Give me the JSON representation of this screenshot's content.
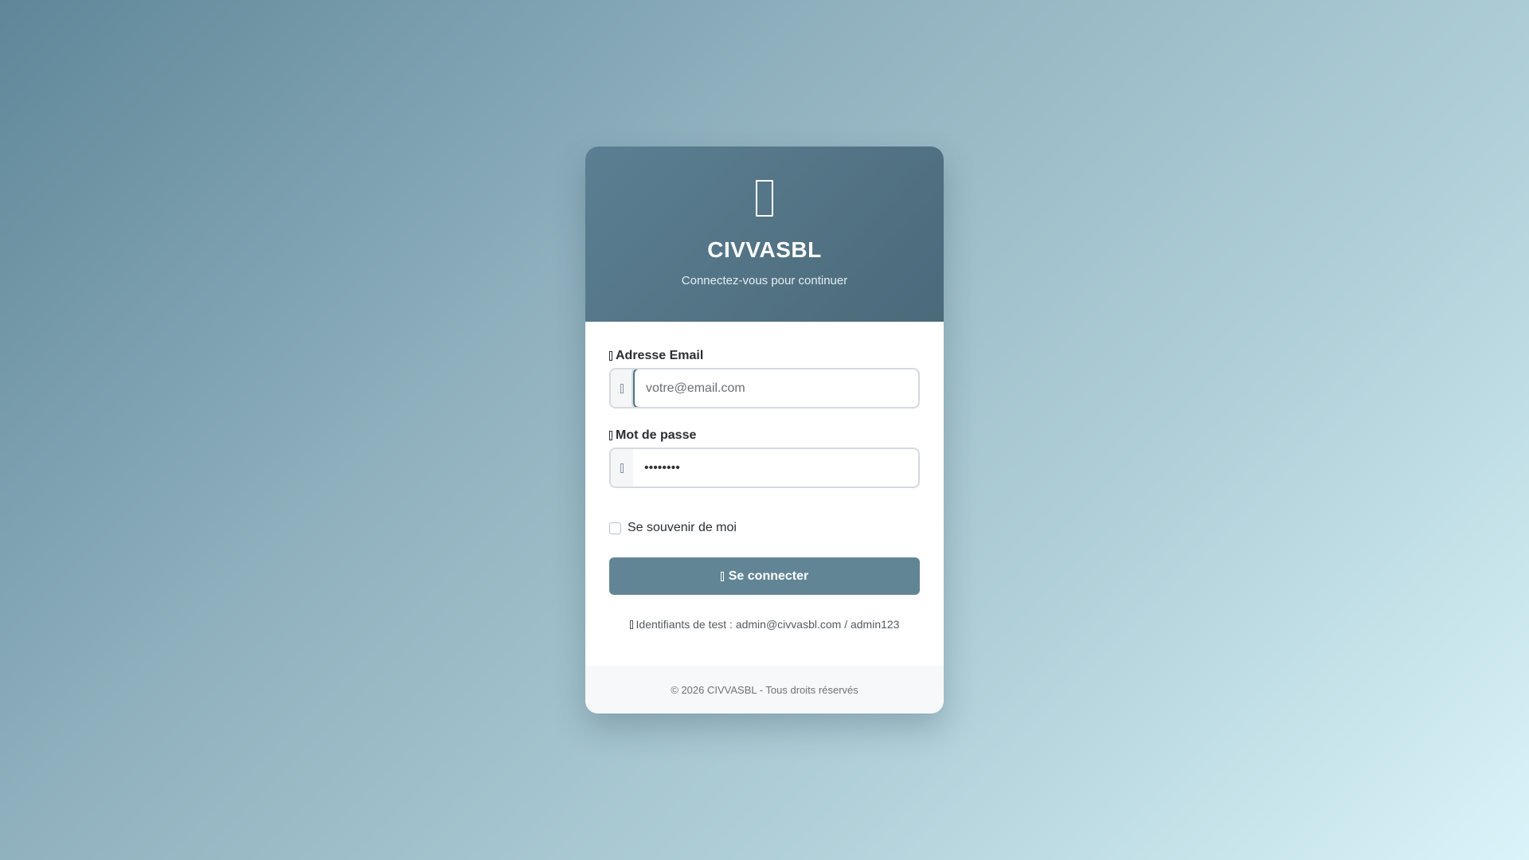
{
  "header": {
    "logo_icon": "app-logo-icon",
    "title": "CIVVASBL",
    "subtitle": "Connectez-vous pour continuer"
  },
  "form": {
    "email": {
      "label_icon": "envelope-icon",
      "label": "Adresse Email",
      "addon_icon": "at-icon",
      "value": "",
      "placeholder": "votre@email.com"
    },
    "password": {
      "label_icon": "lock-icon",
      "label": "Mot de passe",
      "addon_icon": "key-icon",
      "value": "••••••••"
    },
    "remember": {
      "label": "Se souvenir de moi",
      "checked": false
    },
    "submit": {
      "icon": "sign-in-icon",
      "label": "Se connecter"
    },
    "hint": {
      "icon": "info-icon",
      "text": "Identifiants de test : admin@civvasbl.com / admin123"
    }
  },
  "footer": {
    "copyright": "© 2026 CIVVASBL - Tous droits réservés"
  },
  "colors": {
    "header": "#52778a",
    "button": "#628595",
    "focus_border": "#4f7386"
  }
}
